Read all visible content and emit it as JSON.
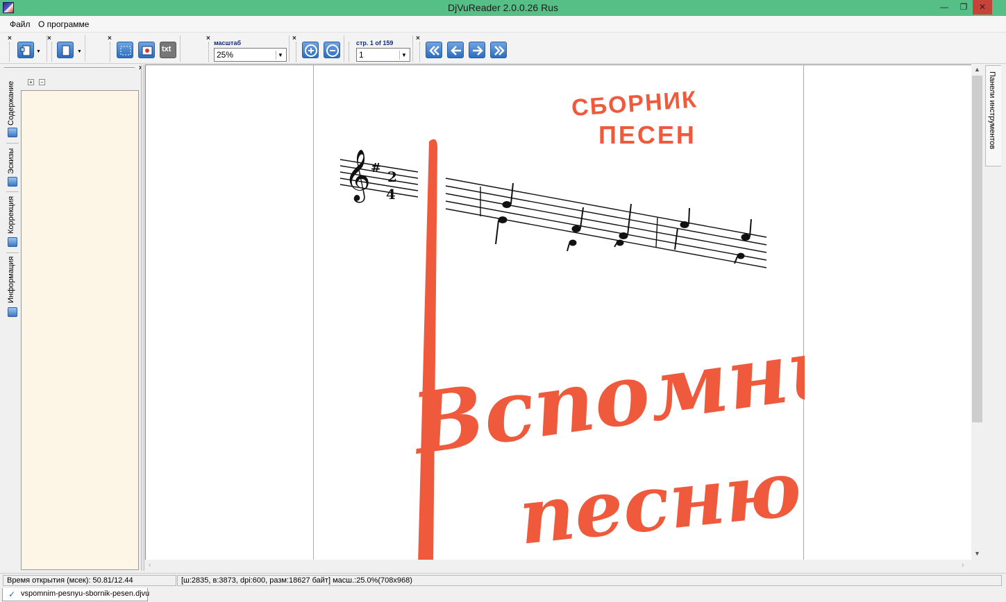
{
  "window": {
    "title": "DjVuReader 2.0.0.26 Rus"
  },
  "menu": {
    "items": [
      "Файл",
      "О программе"
    ]
  },
  "toolbar": {
    "zoom_label": "масштаб",
    "zoom_value": "25%",
    "page_label": "стр. 1 of 159",
    "page_value": "1",
    "text_button": "txt"
  },
  "left_tabs": [
    "Содержание",
    "Эскизы",
    "Коррекция",
    "Информация"
  ],
  "right_tab": {
    "label": "Панели инструментов"
  },
  "document": {
    "cover_title_line1": "СБОРНИК",
    "cover_title_line2": "ПЕСЕН",
    "cover_script_line1": "Вспомним",
    "cover_script_line2": "песню",
    "cover_color": "#f05a3c",
    "music_time_top": "2",
    "music_time_bottom": "4",
    "music_sharp": "#"
  },
  "status": {
    "open_time": "Время открытия (мсек): 50.81/12.44",
    "info": "[ш:2835, в:3873, dpi:600, разм:18627 байт] масш.:25.0%(708x968)"
  },
  "doc_tab": {
    "filename": "vspomnim-pesnyu-sbornik-pesen.djvu"
  },
  "colors": {
    "titlebar": "#56bf86",
    "close": "#c7433a",
    "outline_bg": "#fdf5e6"
  }
}
